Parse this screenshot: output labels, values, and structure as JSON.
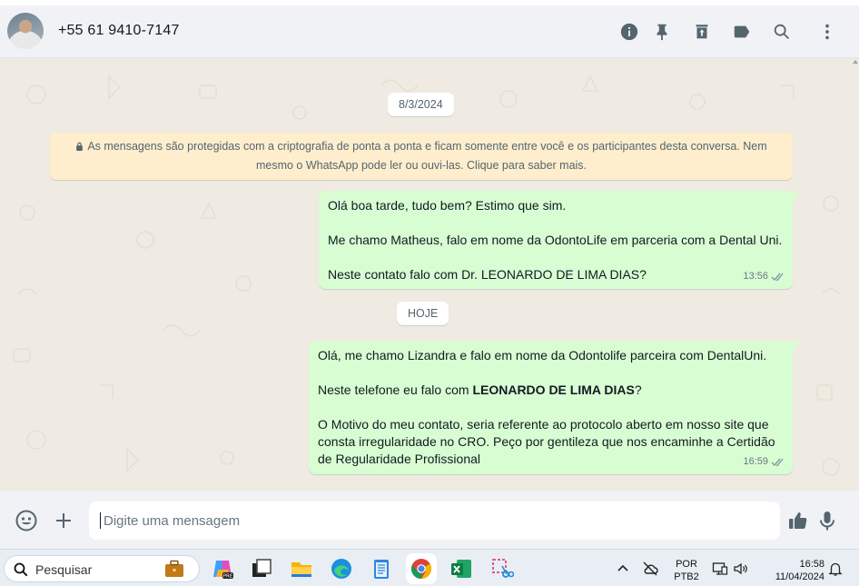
{
  "header": {
    "contact_name": "+55 61 9410-7147",
    "icons": [
      "info-icon",
      "pin-icon",
      "archive-icon",
      "label-icon",
      "search-icon",
      "menu-icon"
    ]
  },
  "chat": {
    "date_1": "8/3/2024",
    "encryption_notice": "As mensagens são protegidas com a criptografia de ponta a ponta e ficam somente entre você e os participantes desta conversa. Nem mesmo o WhatsApp pode ler ou ouvi-las. Clique para saber mais.",
    "encryption_notice_line1": "As mensagens são protegidas com a criptografia de ponta a ponta e ficam somente entre você e os participantes desta conversa. Nem",
    "encryption_notice_line2": "mesmo o WhatsApp pode ler ou ouvi-las. Clique para saber mais.",
    "messages": [
      {
        "lines": [
          "Olá boa tarde, tudo bem? Estimo que sim.",
          "Me chamo Matheus, falo em nome da OdontoLife em parceria com a Dental Uni.",
          "Neste contato falo com Dr. LEONARDO DE LIMA DIAS?"
        ],
        "time": "13:56"
      },
      {
        "line1": "Olá, me chamo Lizandra e falo em nome da Odontolife parceira com DentalUni.",
        "line2_prefix": "Neste telefone eu falo com ",
        "line2_bold": "LEONARDO DE LIMA DIAS",
        "line2_suffix": "?",
        "line3": [
          "O Motivo do meu contato, seria referente ao protocolo aberto em nosso site que",
          "consta irregularidade no CRO. Peço por gentileza que nos encaminhe a Certidão",
          "de Regularidade Profissional"
        ],
        "time": "16:59"
      }
    ],
    "date_2": "HOJE"
  },
  "composer": {
    "placeholder": "Digite uma mensagem"
  },
  "taskbar": {
    "search_label": "Pesquisar",
    "lang_line1": "POR",
    "lang_line2": "PTB2",
    "time": "16:58",
    "date": "11/04/2024"
  },
  "colors": {
    "outgoing_bubble": "#d9fdd3",
    "chat_background": "#efeae2",
    "notice_background": "#ffeecd",
    "icon_gray": "#54656f",
    "tick_gray": "#8696a0"
  }
}
